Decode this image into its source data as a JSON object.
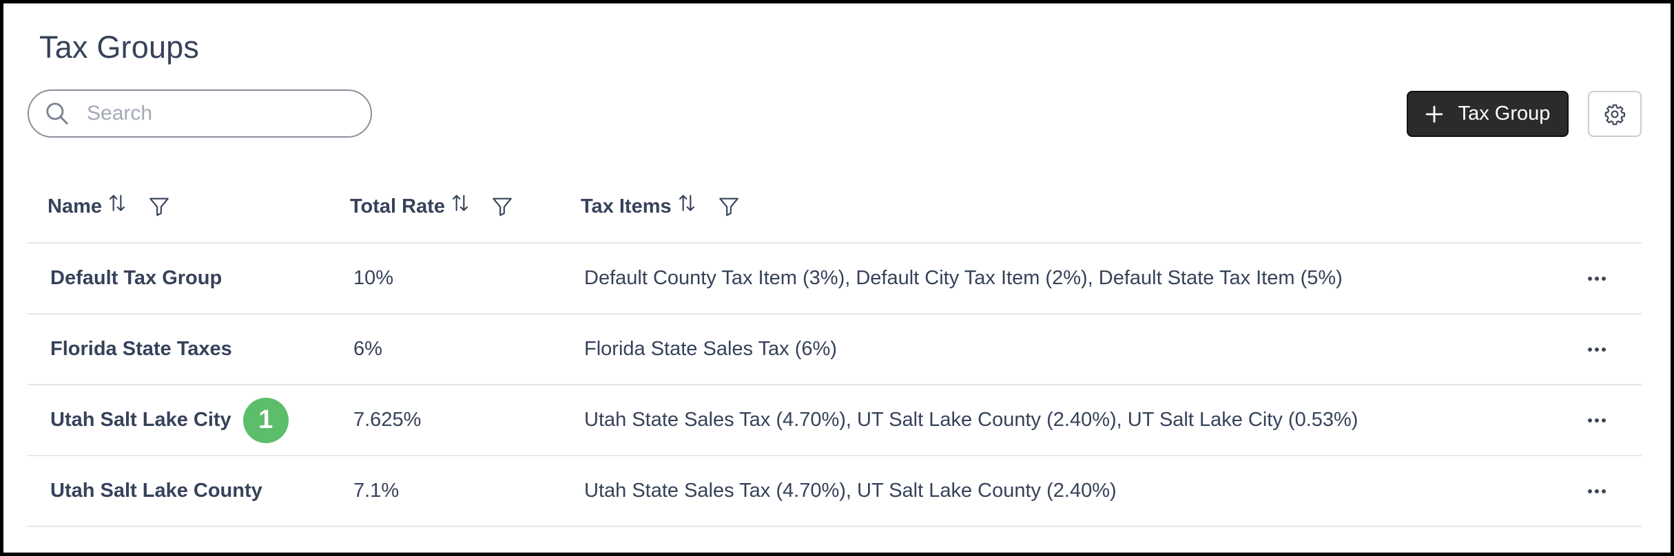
{
  "page": {
    "title": "Tax Groups"
  },
  "search": {
    "placeholder": "Search"
  },
  "toolbar": {
    "add_label": "Tax Group"
  },
  "columns": [
    {
      "label": "Name"
    },
    {
      "label": "Total Rate"
    },
    {
      "label": "Tax Items"
    }
  ],
  "rows": [
    {
      "name": "Default Tax Group",
      "rate": "10%",
      "items": "Default County Tax Item (3%), Default City Tax Item (2%), Default State Tax Item (5%)"
    },
    {
      "name": "Florida State Taxes",
      "rate": "6%",
      "items": "Florida State Sales Tax (6%)"
    },
    {
      "name": "Utah Salt Lake City",
      "rate": "7.625%",
      "items": "Utah State Sales Tax (4.70%), UT Salt Lake County (2.40%), UT Salt Lake City (0.53%)",
      "badge": "1"
    },
    {
      "name": "Utah Salt Lake County",
      "rate": "7.1%",
      "items": "Utah State Sales Tax (4.70%), UT Salt Lake County (2.40%)"
    }
  ],
  "colors": {
    "primary_button": "#2b2b2c",
    "badge": "#5cbd6b"
  }
}
